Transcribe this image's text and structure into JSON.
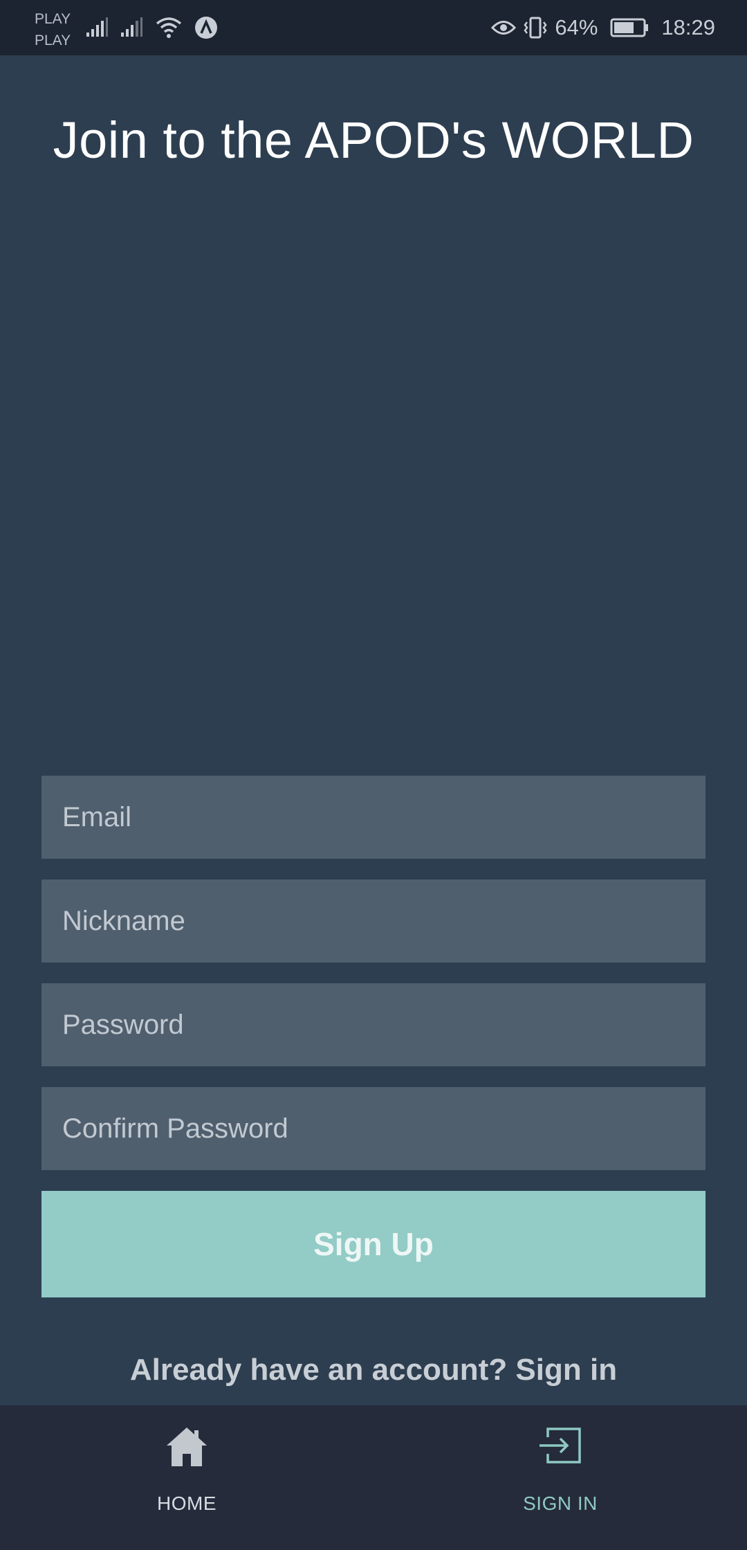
{
  "status_bar": {
    "carrier_1": "PLAY",
    "carrier_2": "PLAY",
    "battery_percent": "64%",
    "time": "18:29",
    "icons_left": [
      "signal-icon",
      "signal-icon",
      "wifi-icon",
      "notification-a-icon"
    ],
    "icons_right": [
      "eye-icon",
      "vibrate-icon",
      "battery-icon"
    ]
  },
  "header": {
    "title": "Join to the APOD's WORLD"
  },
  "form": {
    "email_placeholder": "Email",
    "nickname_placeholder": "Nickname",
    "password_placeholder": "Password",
    "confirm_password_placeholder": "Confirm Password",
    "submit_label": "Sign Up",
    "signin_link": "Already have an account? Sign in"
  },
  "bottom_nav": {
    "items": [
      {
        "label": "HOME",
        "icon": "home-icon",
        "active": false
      },
      {
        "label": "SIGN IN",
        "icon": "sign-in-icon",
        "active": true
      }
    ]
  },
  "colors": {
    "background": "#2d3e50",
    "input_background": "#4f5f6e",
    "accent": "#93cbc6",
    "nav_background": "#252b3a"
  }
}
